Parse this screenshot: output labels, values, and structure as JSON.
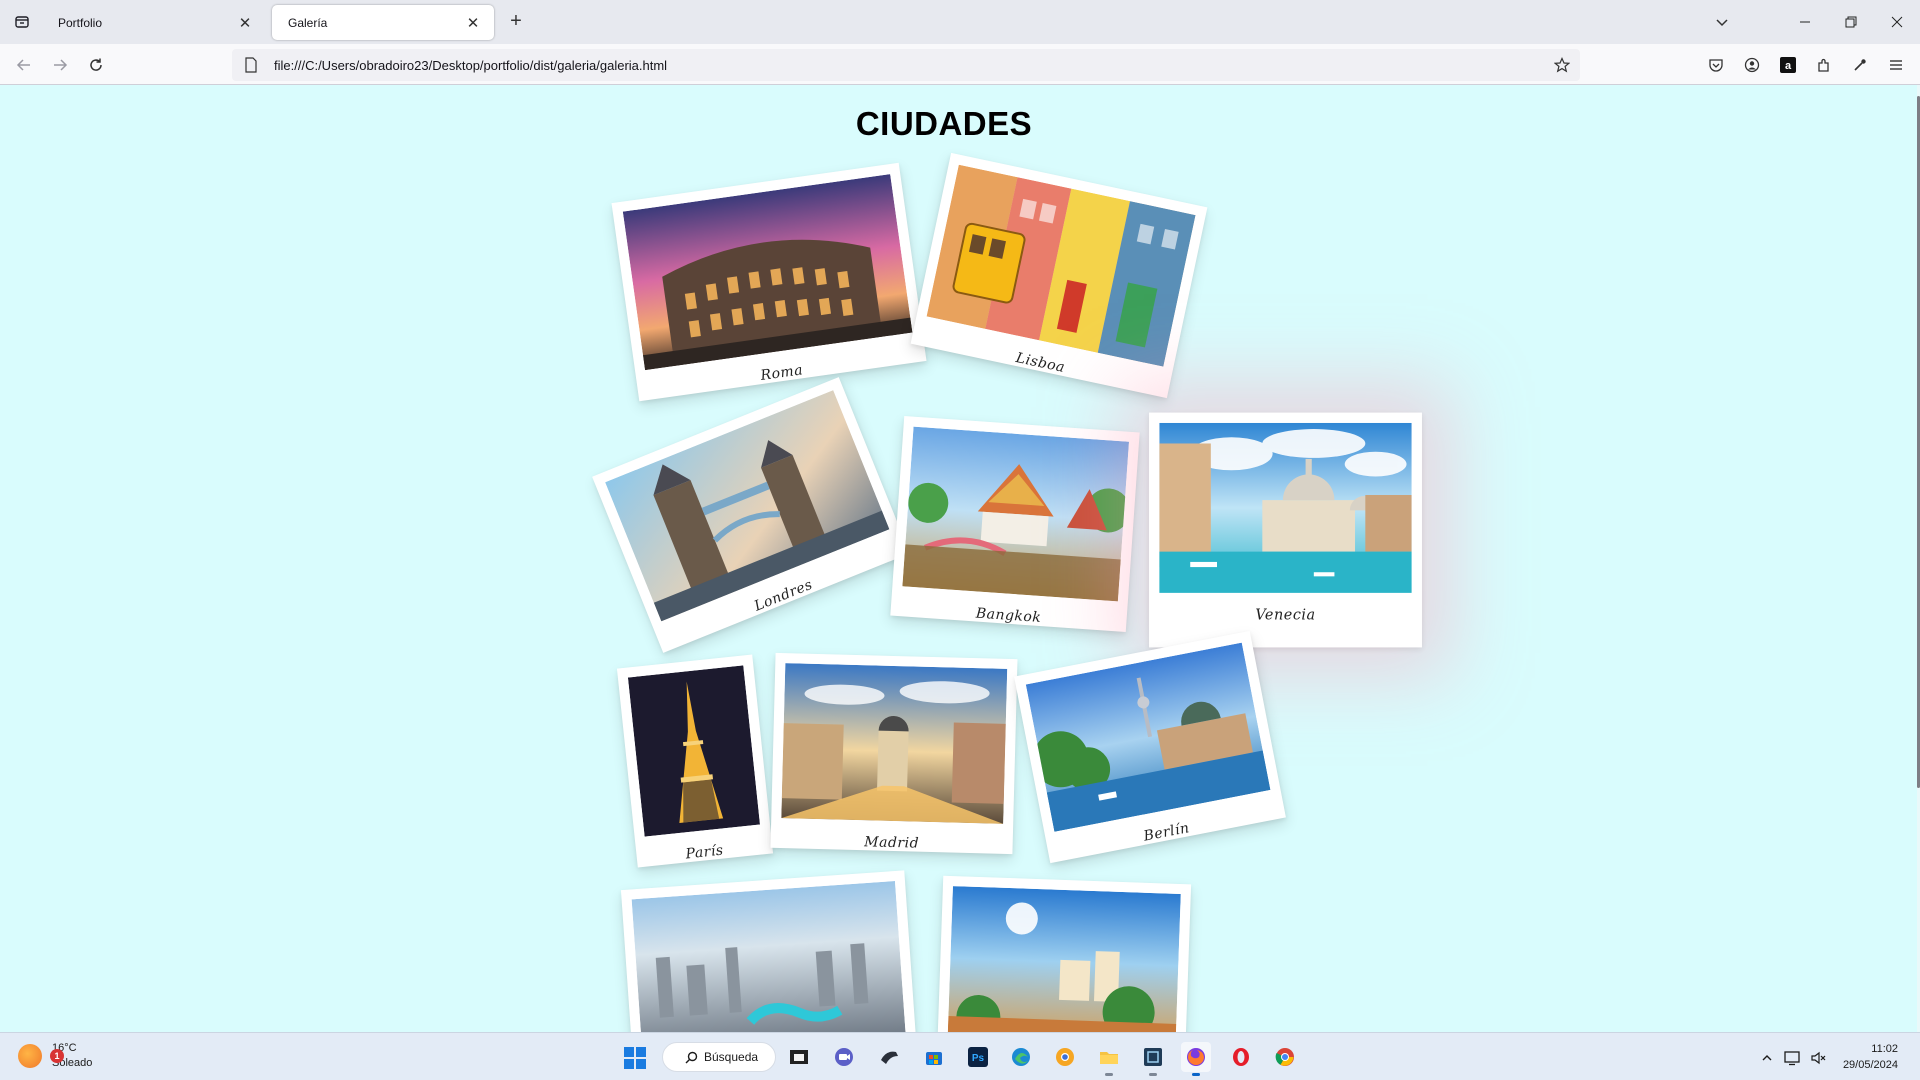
{
  "browser": {
    "tabs": [
      {
        "label": "Portfolio",
        "active": false
      },
      {
        "label": "Galería",
        "active": true
      }
    ],
    "url": "file:///C:/Users/obradoiro23/Desktop/portfolio/dist/galeria/galeria.html"
  },
  "page": {
    "title": "CIUDADES",
    "cards": [
      {
        "caption": "Roma",
        "scene": "colosseum-sunset"
      },
      {
        "caption": "Lisboa",
        "scene": "yellow-tram-colorful-houses"
      },
      {
        "caption": "Londres",
        "scene": "tower-bridge"
      },
      {
        "caption": "Bangkok",
        "scene": "thai-temple-river"
      },
      {
        "caption": "Venecia",
        "scene": "grand-canal-domes",
        "hovered": true
      },
      {
        "caption": "París",
        "scene": "eiffel-tower-night"
      },
      {
        "caption": "Madrid",
        "scene": "gran-via-sunset"
      },
      {
        "caption": "Berlín",
        "scene": "museum-island-river"
      },
      {
        "caption": "",
        "scene": "dubai-aerial"
      },
      {
        "caption": "",
        "scene": "coastal-town-sunny"
      }
    ]
  },
  "taskbar": {
    "weather": {
      "temp": "16°C",
      "condition": "Soleado",
      "badge": "1"
    },
    "search_label": "Búsqueda",
    "time": "11:02",
    "date": "29/05/2024",
    "apps": [
      "file-explorer-icon",
      "meet-icon",
      "pinned-app-icon",
      "store-icon",
      "photoshop-icon",
      "edge-icon",
      "chrome-dev-icon",
      "folder-icon",
      "editor-icon",
      "firefox-icon",
      "opera-icon",
      "chrome-icon"
    ]
  },
  "colors": {
    "page_background": "#d9fcfd",
    "hover_glow": "#ff96af"
  }
}
